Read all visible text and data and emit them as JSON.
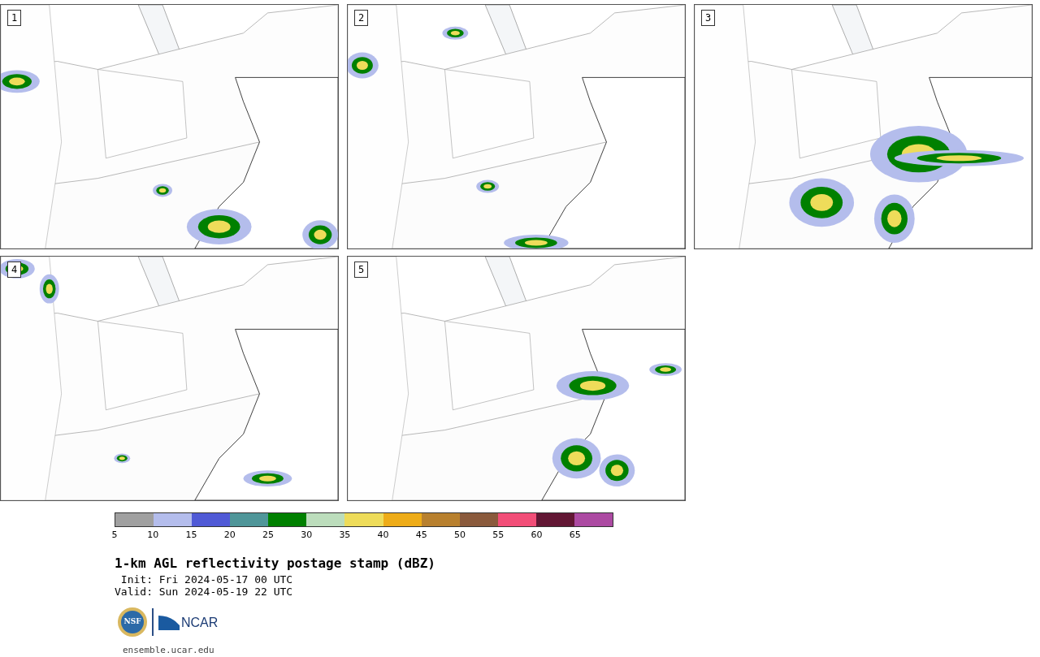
{
  "panels": [
    {
      "number": "1"
    },
    {
      "number": "2"
    },
    {
      "number": "3"
    },
    {
      "number": "4"
    },
    {
      "number": "5"
    }
  ],
  "colorbar": {
    "segments": [
      {
        "color": "#a0a0a0"
      },
      {
        "color": "#b4bdec"
      },
      {
        "color": "#505ad6"
      },
      {
        "color": "#4f9699"
      },
      {
        "color": "#008000"
      },
      {
        "color": "#bcddbc"
      },
      {
        "color": "#eedc5a"
      },
      {
        "color": "#eeac18"
      },
      {
        "color": "#b8802e"
      },
      {
        "color": "#8a5a3c"
      },
      {
        "color": "#f24e78"
      },
      {
        "color": "#621734"
      },
      {
        "color": "#ac4aa2"
      }
    ],
    "ticks": [
      "5",
      "10",
      "15",
      "20",
      "25",
      "30",
      "35",
      "40",
      "45",
      "50",
      "55",
      "60",
      "65"
    ]
  },
  "title": "1-km AGL reflectivity postage stamp (dBZ)",
  "init": " Init: Fri 2024-05-17 00 UTC",
  "valid": "Valid: Sun 2024-05-19 22 UTC",
  "logos": {
    "nsf": "NSF",
    "ncar": "NCAR"
  },
  "url": "ensemble.ucar.edu"
}
